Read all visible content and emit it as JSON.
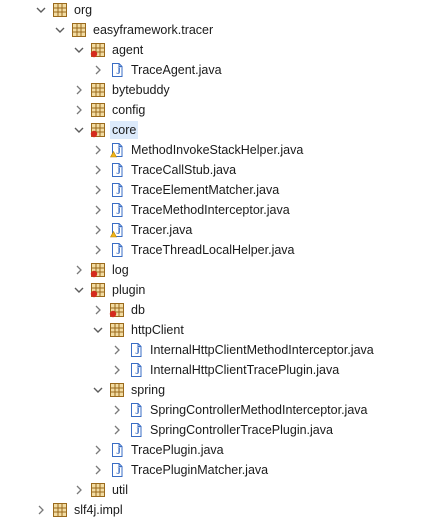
{
  "tree": {
    "nodes": [
      {
        "label": "org",
        "type": "package",
        "depth": 0,
        "state": "expanded",
        "name": "org"
      },
      {
        "label": "easyframework.tracer",
        "type": "package",
        "depth": 1,
        "state": "expanded",
        "name": "easyframework-tracer"
      },
      {
        "label": "agent",
        "type": "package-error",
        "depth": 2,
        "state": "expanded",
        "name": "agent"
      },
      {
        "label": "TraceAgent.java",
        "type": "java",
        "depth": 3,
        "state": "collapsed",
        "name": "traceagent-java"
      },
      {
        "label": "bytebuddy",
        "type": "package",
        "depth": 2,
        "state": "collapsed",
        "name": "bytebuddy"
      },
      {
        "label": "config",
        "type": "package",
        "depth": 2,
        "state": "collapsed",
        "name": "config"
      },
      {
        "label": "core",
        "type": "package-error",
        "depth": 2,
        "state": "expanded",
        "selected": true,
        "name": "core"
      },
      {
        "label": "MethodInvokeStackHelper.java",
        "type": "java-error",
        "depth": 3,
        "state": "collapsed",
        "name": "methodinvokestackhelper-java"
      },
      {
        "label": "TraceCallStub.java",
        "type": "java",
        "depth": 3,
        "state": "collapsed",
        "name": "tracecallstub-java"
      },
      {
        "label": "TraceElementMatcher.java",
        "type": "java",
        "depth": 3,
        "state": "collapsed",
        "name": "traceelementmatcher-java"
      },
      {
        "label": "TraceMethodInterceptor.java",
        "type": "java",
        "depth": 3,
        "state": "collapsed",
        "name": "tracemethodinterceptor-java"
      },
      {
        "label": "Tracer.java",
        "type": "java-error",
        "depth": 3,
        "state": "collapsed",
        "name": "tracer-java"
      },
      {
        "label": "TraceThreadLocalHelper.java",
        "type": "java",
        "depth": 3,
        "state": "collapsed",
        "name": "tracethreadlocalhelper-java"
      },
      {
        "label": "log",
        "type": "package-error",
        "depth": 2,
        "state": "collapsed",
        "name": "log"
      },
      {
        "label": "plugin",
        "type": "package-error",
        "depth": 2,
        "state": "expanded",
        "name": "plugin"
      },
      {
        "label": "db",
        "type": "package-error",
        "depth": 3,
        "state": "collapsed",
        "name": "db"
      },
      {
        "label": "httpClient",
        "type": "package",
        "depth": 3,
        "state": "expanded",
        "name": "httpclient"
      },
      {
        "label": "InternalHttpClientMethodInterceptor.java",
        "type": "java",
        "depth": 4,
        "state": "collapsed",
        "name": "internalhttpclientmethodinterceptor-java"
      },
      {
        "label": "InternalHttpClientTracePlugin.java",
        "type": "java",
        "depth": 4,
        "state": "collapsed",
        "name": "internalhttpclienttraceplugin-java"
      },
      {
        "label": "spring",
        "type": "package",
        "depth": 3,
        "state": "expanded",
        "name": "spring"
      },
      {
        "label": "SpringControllerMethodInterceptor.java",
        "type": "java",
        "depth": 4,
        "state": "collapsed",
        "name": "springcontrollermethodinterceptor-java"
      },
      {
        "label": "SpringControllerTracePlugin.java",
        "type": "java",
        "depth": 4,
        "state": "collapsed",
        "name": "springcontrollertraceplugin-java"
      },
      {
        "label": "TracePlugin.java",
        "type": "java",
        "depth": 3,
        "state": "collapsed",
        "name": "traceplugin-java"
      },
      {
        "label": "TracePluginMatcher.java",
        "type": "java",
        "depth": 3,
        "state": "collapsed",
        "name": "tracepluginmatcher-java"
      },
      {
        "label": "util",
        "type": "package",
        "depth": 2,
        "state": "collapsed",
        "name": "util"
      },
      {
        "label": "slf4j.impl",
        "type": "package",
        "depth": 0,
        "state": "collapsed",
        "name": "slf4j-impl"
      }
    ]
  },
  "colors": {
    "package_brown": "#9a6a1d",
    "package_fill": "#f2dca2",
    "java_blue": "#3a6dc4",
    "error_red": "#d52b1e",
    "warning_yellow": "#f0b419",
    "selection": "#dceafb"
  }
}
